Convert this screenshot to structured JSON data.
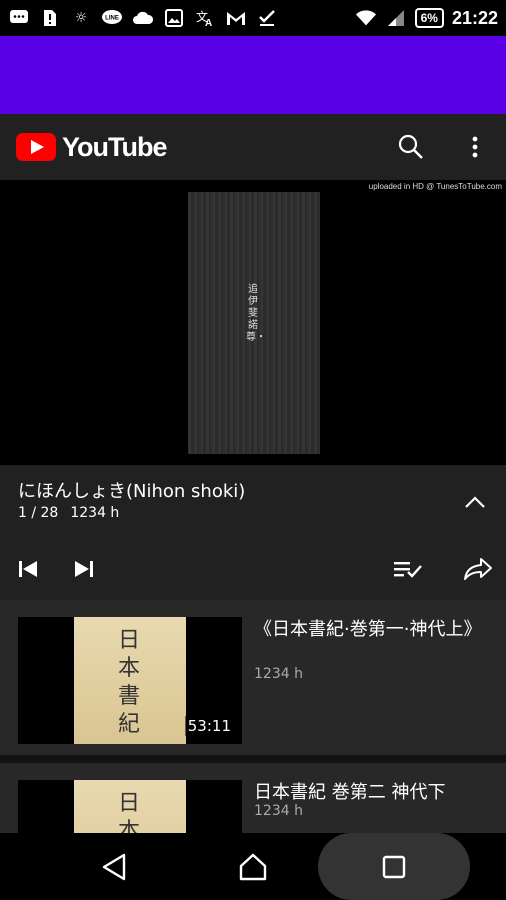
{
  "status_bar": {
    "battery": "6%",
    "time": "21:22",
    "icons": [
      "chat-icon",
      "sim-alert-icon",
      "brightness-icon",
      "line-icon",
      "cloud-icon",
      "image-icon",
      "translate-icon",
      "gmail-icon",
      "check-icon",
      "wifi-icon",
      "signal-icon",
      "battery-icon"
    ]
  },
  "app_bar": {
    "logo_text": "YouTube",
    "brand_color": "#ff0000",
    "actions": [
      "search-icon",
      "more-vert-icon"
    ]
  },
  "video": {
    "watermark": "uploaded in HD @ TunesToTube.com",
    "scroll_text": "追伊斐諾尊・"
  },
  "playlist": {
    "title": "にほんしょき(Nihon shoki)",
    "position": "1 / 28",
    "views": "1234 h",
    "controls": [
      "previous-icon",
      "next-icon",
      "playlist-add-check-icon",
      "share-icon"
    ]
  },
  "items": [
    {
      "title": "《日本書紀·巻第一·神代上》",
      "views": "1234 h",
      "duration": "53:11",
      "thumb_text": "日本書紀"
    },
    {
      "title": "日本書紀 巻第二 神代下",
      "views": "1234 h",
      "duration": "",
      "thumb_text": "日本書"
    }
  ],
  "nav": [
    "back-icon",
    "home-icon",
    "recents-icon"
  ]
}
